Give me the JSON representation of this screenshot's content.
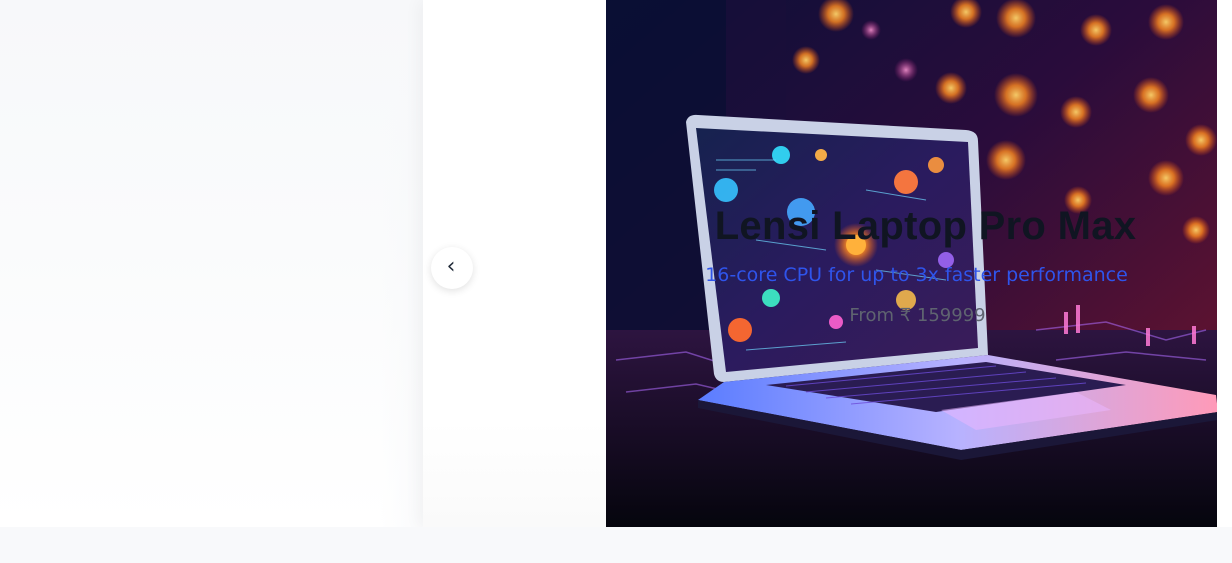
{
  "hero": {
    "slide": {
      "title": "Lensi Laptop Pro Max",
      "subtitle": "16-core CPU for up to 3x faster performance",
      "price": "From ₹ 159999"
    },
    "controls": {
      "prev_icon": "chevron-left-icon",
      "prev_glyph": "‹"
    }
  },
  "colors": {
    "accent": "#2f54eb",
    "title": "#101522",
    "price": "#5f6470",
    "page_bg": "#f8f9fb"
  }
}
